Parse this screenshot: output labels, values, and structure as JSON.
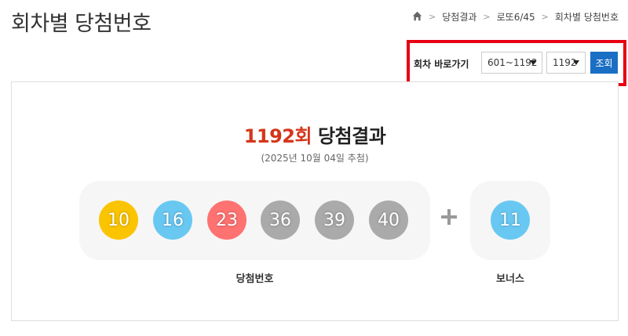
{
  "page": {
    "title": "회차별 당첨번호"
  },
  "breadcrumb": {
    "home_icon": "home-icon",
    "items": [
      "당첨결과",
      "로또6/45",
      "회차별 당첨번호"
    ]
  },
  "round_jump": {
    "label": "회차 바로가기",
    "range_select": "601~1192",
    "round_select": "1192",
    "search_label": "조회",
    "highlight_color": "#e60012",
    "button_color": "#1a6fc4"
  },
  "result": {
    "round_text": "1192회",
    "title_suffix": " 당첨결과",
    "date_text": "(2025년 10월 04일 추첨)",
    "numbers": [
      {
        "value": "10",
        "color": "#fbc400"
      },
      {
        "value": "16",
        "color": "#69c8f2"
      },
      {
        "value": "23",
        "color": "#ff7272"
      },
      {
        "value": "36",
        "color": "#aaaaaa"
      },
      {
        "value": "39",
        "color": "#aaaaaa"
      },
      {
        "value": "40",
        "color": "#aaaaaa"
      }
    ],
    "bonus": {
      "value": "11",
      "color": "#69c8f2"
    },
    "winning_caption": "당첨번호",
    "bonus_caption": "보너스"
  }
}
